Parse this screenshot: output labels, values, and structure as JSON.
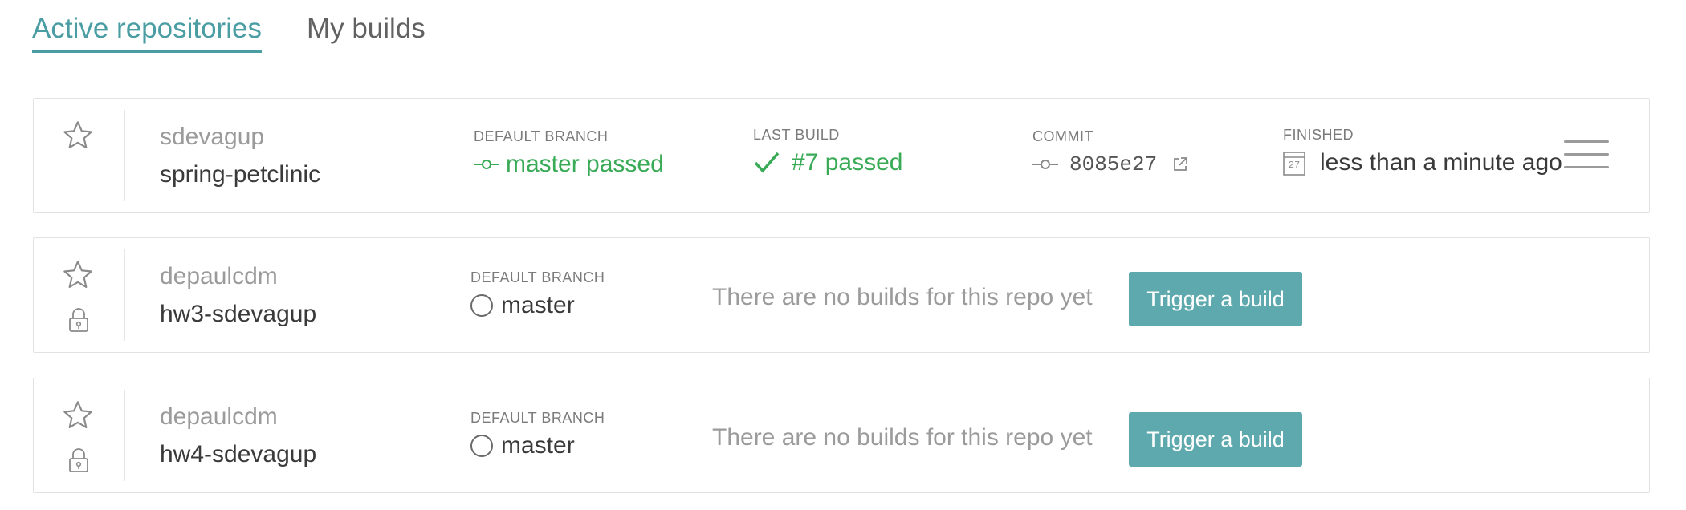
{
  "tabs": [
    {
      "label": "Active repositories",
      "active": true
    },
    {
      "label": "My builds",
      "active": false
    }
  ],
  "repos": [
    {
      "owner": "sdevagup",
      "name": "spring-petclinic",
      "private": false,
      "default_branch_label": "DEFAULT BRANCH",
      "default_branch_text": "master passed",
      "last_build_label": "LAST BUILD",
      "last_build_text": "#7 passed",
      "commit_label": "COMMIT",
      "commit_sha": "8085e27",
      "finished_label": "FINISHED",
      "finished_text": "less than a minute ago",
      "calendar_day": "27"
    },
    {
      "owner": "depaulcdm",
      "name": "hw3-sdevagup",
      "private": true,
      "default_branch_label": "DEFAULT BRANCH",
      "default_branch_text": "master",
      "no_builds_text": "There are no builds for this repo yet",
      "trigger_label": "Trigger a build"
    },
    {
      "owner": "depaulcdm",
      "name": "hw4-sdevagup",
      "private": true,
      "default_branch_label": "DEFAULT BRANCH",
      "default_branch_text": "master",
      "no_builds_text": "There are no builds for this repo yet",
      "trigger_label": "Trigger a build"
    }
  ],
  "colors": {
    "accent": "#4a9da3",
    "passed": "#39aa56",
    "button": "#5ea9ad",
    "muted": "#9b9b9b"
  },
  "icons": [
    "star-icon",
    "lock-icon",
    "commit-icon",
    "check-icon",
    "external-link-icon",
    "calendar-icon",
    "hamburger-menu-icon",
    "branch-status-circle-icon"
  ]
}
